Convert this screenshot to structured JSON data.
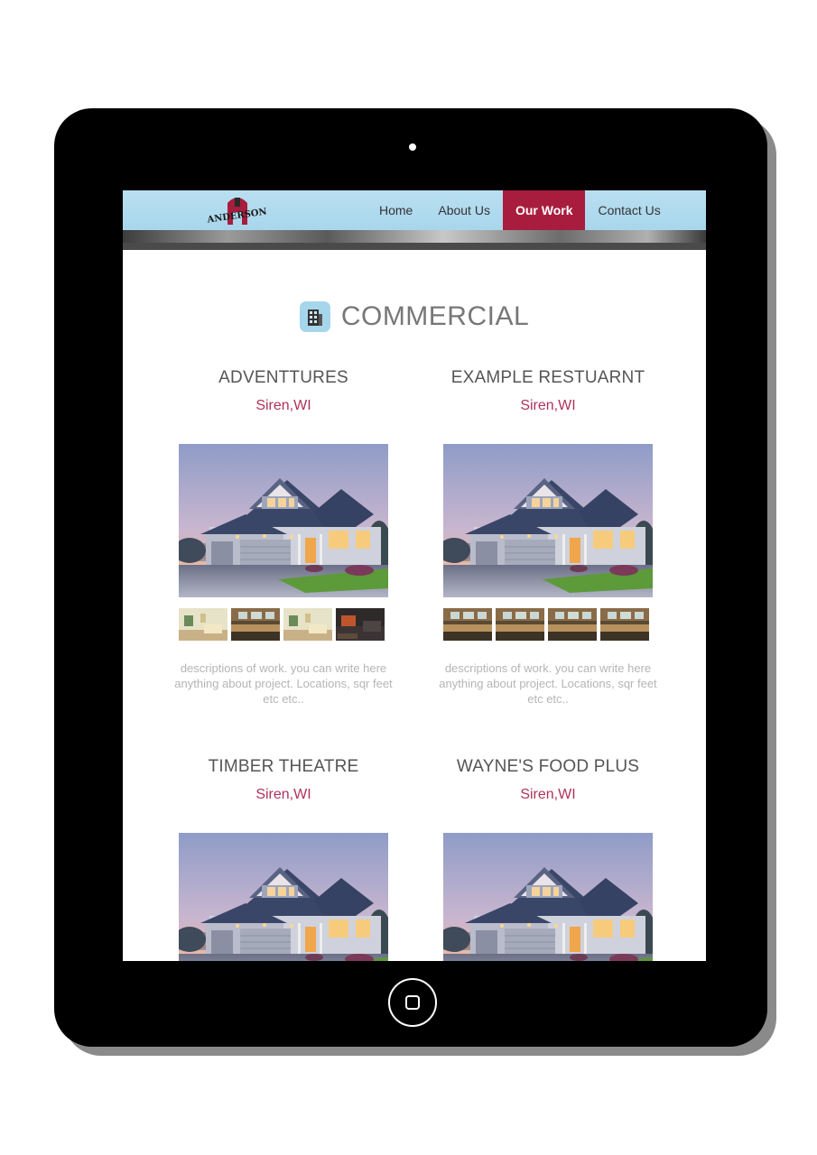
{
  "site": {
    "logo_text": "ANDERSON",
    "nav": [
      {
        "label": "Home",
        "active": false
      },
      {
        "label": "About Us",
        "active": false
      },
      {
        "label": "Our Work",
        "active": true
      },
      {
        "label": "Contact Us",
        "active": false
      }
    ],
    "accent_color": "#a81d3d",
    "header_color": "#b3dcef"
  },
  "section": {
    "icon": "building-icon",
    "title": "COMMERCIAL"
  },
  "projects": [
    {
      "name": "ADVENTTURES",
      "location": "Siren,WI",
      "description": "descriptions of work. you can write here anything about project. Locations, sqr feet etc etc..",
      "thumbnails": [
        "interior-bright",
        "kitchen",
        "interior-bright",
        "fireplace"
      ]
    },
    {
      "name": "EXAMPLE RESTUARNT",
      "location": "Siren,WI",
      "description": "descriptions of work. you can write here anything about project. Locations, sqr feet etc etc..",
      "thumbnails": [
        "kitchen",
        "kitchen",
        "kitchen",
        "kitchen"
      ]
    },
    {
      "name": "TIMBER THEATRE",
      "location": "Siren,WI"
    },
    {
      "name": "WAYNE'S FOOD PLUS",
      "location": "Siren,WI"
    }
  ]
}
